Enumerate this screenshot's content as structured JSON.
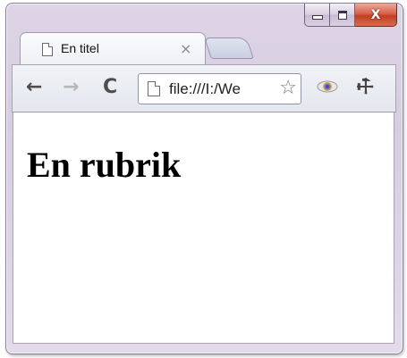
{
  "window": {
    "caption_buttons": {
      "minimize_icon": "minimize-icon",
      "maximize_icon": "maximize-icon",
      "close_glyph": "X"
    }
  },
  "tab": {
    "title": "En titel",
    "close_glyph": "×",
    "icon": "document-icon"
  },
  "toolbar": {
    "back_glyph": "←",
    "forward_glyph": "→",
    "reload_glyph": "C",
    "address": "file:///I:/We",
    "star_glyph": "☆",
    "extension_icon": "eye-icon",
    "wrench_glyph": "🔧"
  },
  "page": {
    "heading": "En rubrik"
  },
  "colors": {
    "frame": "#d6cde1",
    "close_button": "#c13e24",
    "toolbar": "#e4e7ee"
  }
}
